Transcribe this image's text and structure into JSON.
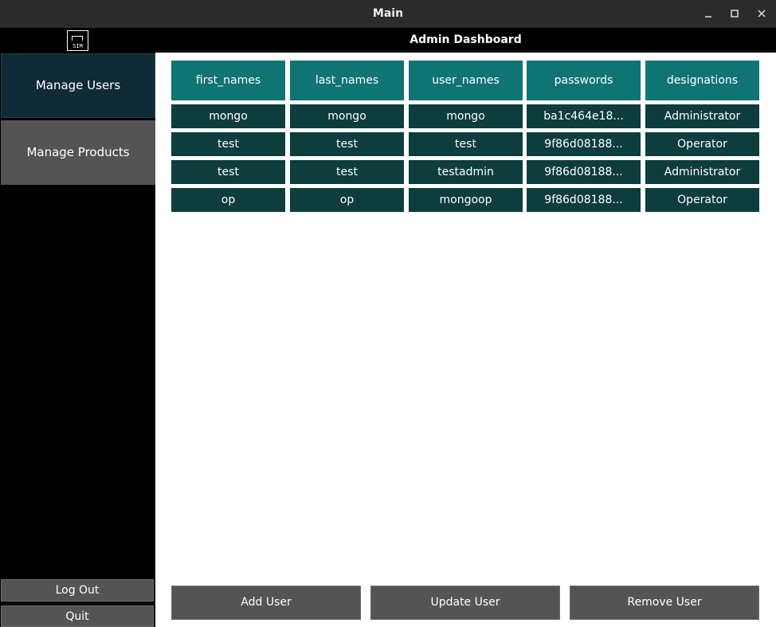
{
  "window": {
    "title": "Main",
    "minimize_icon": "minimize-icon",
    "maximize_icon": "maximize-icon",
    "close_icon": "close-icon"
  },
  "header": {
    "logo_text": "SIM",
    "title": "Admin Dashboard"
  },
  "sidebar": {
    "items": [
      {
        "label": "Manage Users",
        "active": true
      },
      {
        "label": "Manage Products",
        "active": false
      }
    ],
    "logout_label": "Log Out",
    "quit_label": "Quit"
  },
  "table": {
    "columns": [
      "first_names",
      "last_names",
      "user_names",
      "passwords",
      "designations"
    ],
    "rows": [
      [
        "mongo",
        "mongo",
        "mongo",
        "ba1c464e18...",
        "Administrator"
      ],
      [
        "test",
        "test",
        "test",
        "9f86d08188...",
        "Operator"
      ],
      [
        "test",
        "test",
        "testadmin",
        "9f86d08188...",
        "Administrator"
      ],
      [
        "op",
        "op",
        "mongoop",
        "9f86d08188...",
        "Operator"
      ]
    ]
  },
  "actions": {
    "add_label": "Add User",
    "update_label": "Update User",
    "remove_label": "Remove User"
  },
  "colors": {
    "header_cell": "#117474",
    "data_cell": "#0d3d3d",
    "active_nav": "#0f2b38",
    "button": "#545454"
  }
}
